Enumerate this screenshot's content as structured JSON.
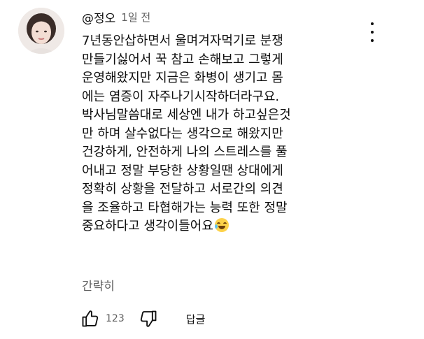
{
  "comment": {
    "author": "@정오",
    "time": "1일 전",
    "text_lines": [
      "7년동안삽하면서 울며겨자먹기로 분쟁",
      "만들기싫어서 꾹 참고 손해보고 그렇게",
      "운영해왔지만 지금은 화병이 생기고 몸",
      "에는 염증이 자주나기시작하더라구요.",
      "박사님말씀대로 세상엔 내가 하고싶은것",
      "만 하며 살수없다는 생각으로 해왔지만",
      "건강하게, 안전하게 나의 스트레스를 풀",
      "어내고 정말 부당한 상황일땐 상대에게",
      "정확히 상황을 전달하고 서로간의 의견",
      "을 조율하고 타협해가는 능력 또한 정말",
      "중요하다고 생각이들어요"
    ],
    "read_less_label": "간략히",
    "like_count": "123",
    "reply_label": "답글"
  },
  "icons": {
    "menu": "kebab-menu-icon",
    "like": "thumbs-up-icon",
    "dislike": "thumbs-down-icon",
    "emoji": "laughing-with-tears-emoji"
  },
  "colors": {
    "text_primary": "#0f0f0f",
    "text_secondary": "#606060"
  }
}
